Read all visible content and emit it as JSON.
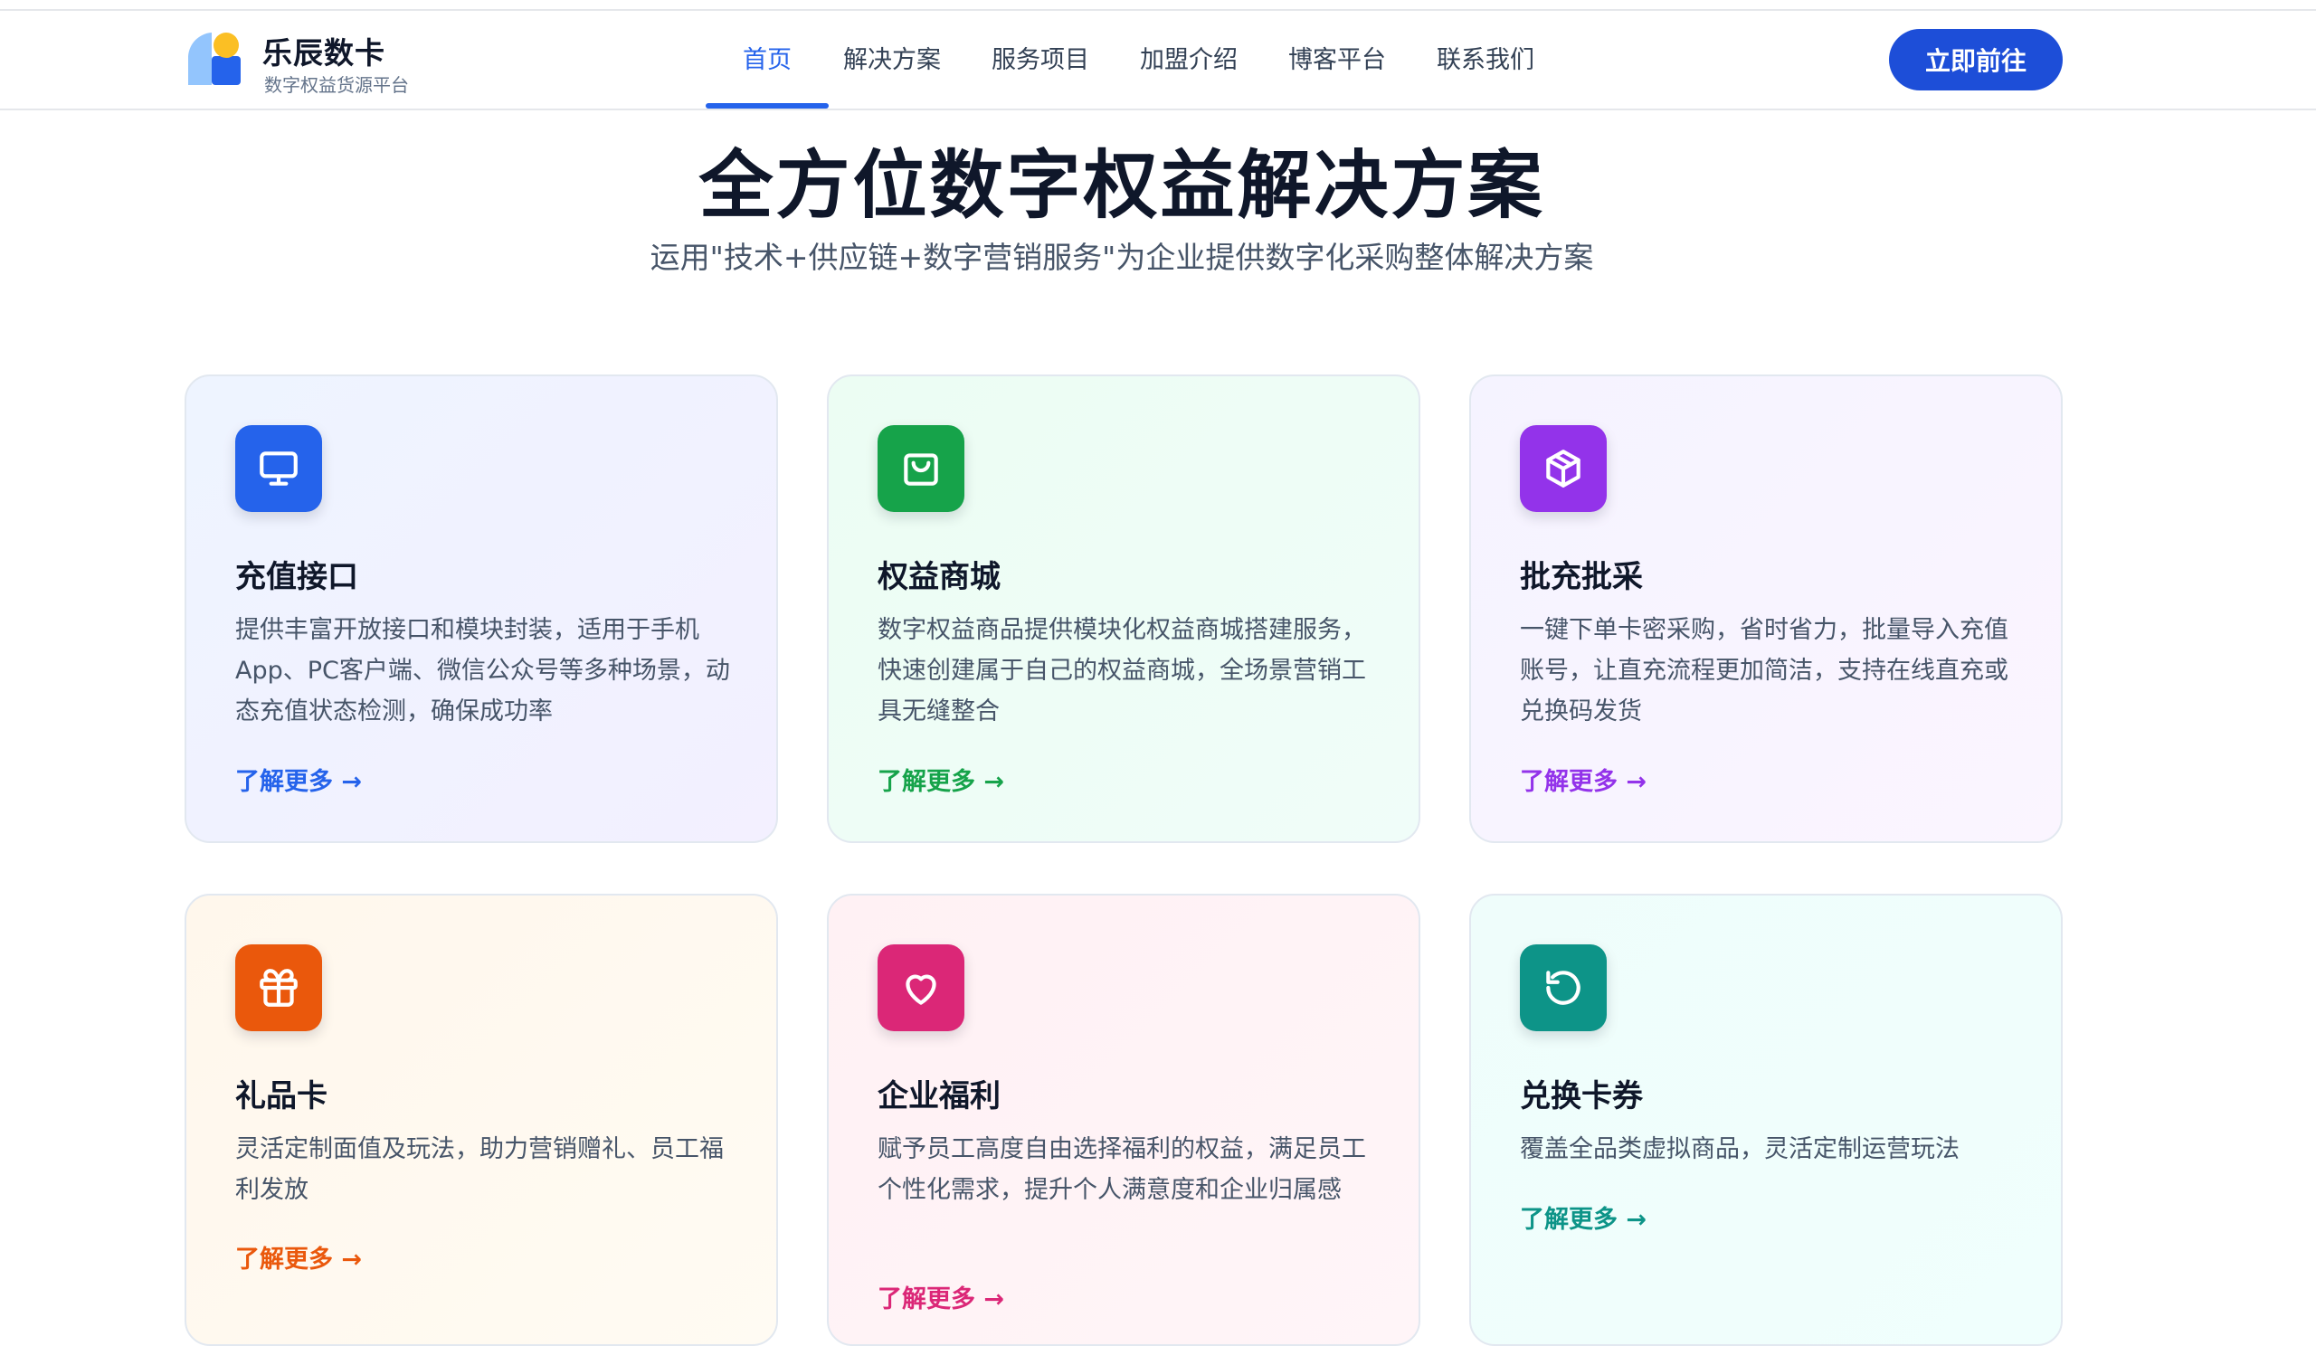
{
  "brand": {
    "name": "乐辰数卡",
    "subtitle": "数字权益货源平台",
    "colors": {
      "blue": "#2563eb",
      "yellow": "#fbbf24",
      "lightblue": "#93c5fd"
    }
  },
  "nav": {
    "items": [
      {
        "label": "首页",
        "active": true
      },
      {
        "label": "解决方案",
        "active": false
      },
      {
        "label": "服务项目",
        "active": false
      },
      {
        "label": "加盟介绍",
        "active": false
      },
      {
        "label": "博客平台",
        "active": false
      },
      {
        "label": "联系我们",
        "active": false
      }
    ],
    "cta_label": "立即前往",
    "accent": "#2563eb"
  },
  "hero": {
    "title": "全方位数字权益解决方案",
    "subtitle": "运用\"技术+供应链+数字营销服务\"为企业提供数字化采购整体解决方案"
  },
  "cards": [
    {
      "title": "充值接口",
      "desc": "提供丰富开放接口和模块封装，适用于手机App、PC客户端、微信公众号等多种场景，动态充值状态检测，确保成功率",
      "link": "了解更多 →",
      "icon": "monitor-icon",
      "color": "#2563eb"
    },
    {
      "title": "权益商城",
      "desc": "数字权益商品提供模块化权益商城搭建服务，快速创建属于自己的权益商城，全场景营销工具无缝整合",
      "link": "了解更多 →",
      "icon": "shopping-bag-icon",
      "color": "#16a34a"
    },
    {
      "title": "批充批采",
      "desc": "一键下单卡密采购，省时省力，批量导入充值账号，让直充流程更加简洁，支持在线直充或兑换码发货",
      "link": "了解更多 →",
      "icon": "package-icon",
      "color": "#9333ea"
    },
    {
      "title": "礼品卡",
      "desc": "灵活定制面值及玩法，助力营销赠礼、员工福利发放",
      "link": "了解更多 →",
      "icon": "gift-icon",
      "color": "#ea580c"
    },
    {
      "title": "企业福利",
      "desc": "赋予员工高度自由选择福利的权益，满足员工个性化需求，提升个人满意度和企业归属感",
      "link": "了解更多 →",
      "icon": "heart-icon",
      "color": "#db2777"
    },
    {
      "title": "兑换卡券",
      "desc": "覆盖全品类虚拟商品，灵活定制运营玩法",
      "link": "了解更多 →",
      "icon": "refresh-icon",
      "color": "#0d9488"
    }
  ]
}
